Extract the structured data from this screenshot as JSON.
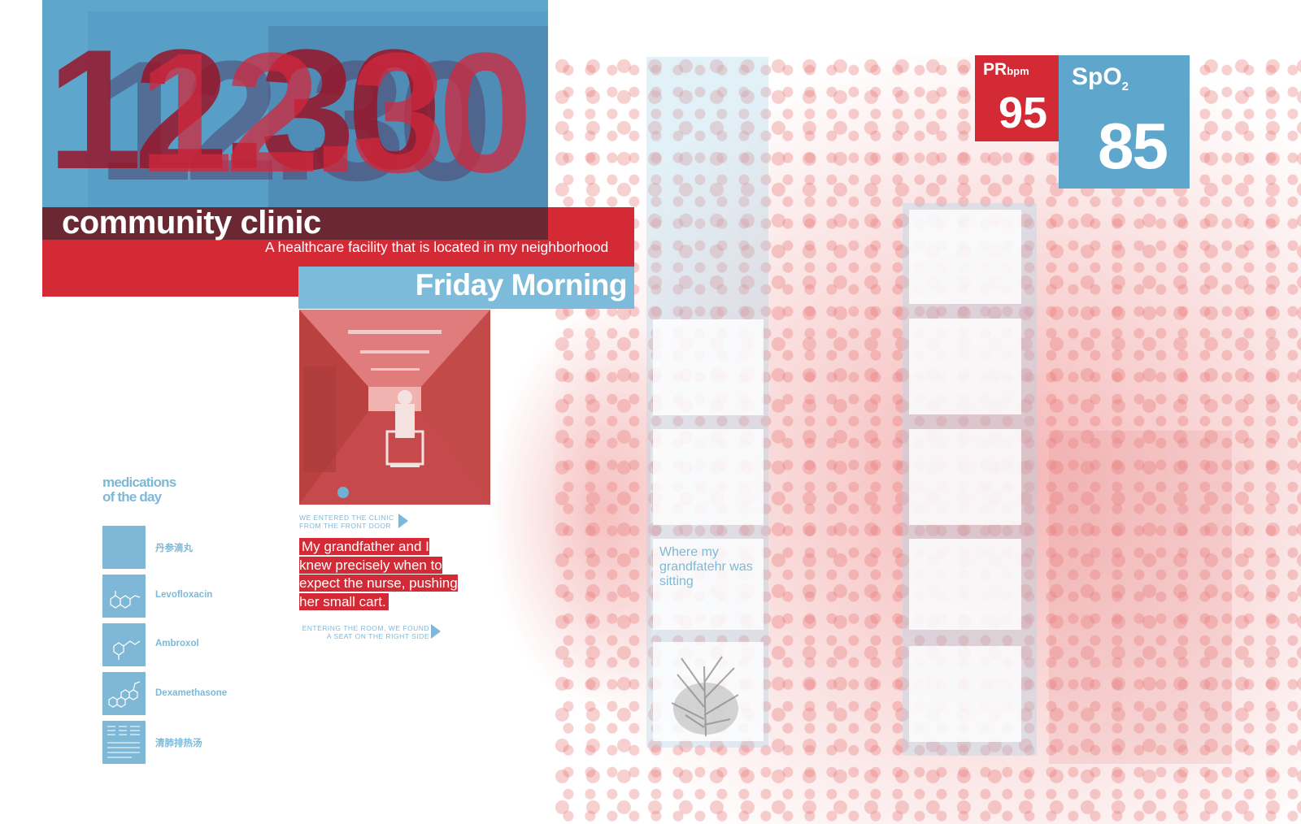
{
  "header": {
    "time": "12.30",
    "place": "community clinic",
    "subtitle": "A healthcare facility that is located in my neighborhood",
    "day": "Friday Morning"
  },
  "story": {
    "caption_top": "WE ENTERED THE CLINIC FROM THE FRONT DOOR",
    "quote": "My grandfather and I knew precisely when to expect the nurse, pushing her small cart.",
    "caption_bottom": "ENTERING THE ROOM, WE FOUND A SEAT ON THE RIGHT SIDE"
  },
  "medications": {
    "title_line1": "medications",
    "title_line2": "of the day",
    "items": [
      {
        "name": "丹参滴丸",
        "icon": "label-icon"
      },
      {
        "name": "Levofloxacin",
        "icon": "molecule-icon"
      },
      {
        "name": "Ambroxol",
        "icon": "molecule-icon"
      },
      {
        "name": "Dexamethasone",
        "icon": "molecule-icon"
      },
      {
        "name": "清肺排热汤",
        "icon": "label-icon"
      }
    ]
  },
  "vitals": {
    "pr_label": "PR",
    "pr_unit": "bpm",
    "pr_value": "95",
    "spo2_label": "SpO",
    "spo2_sub": "2",
    "spo2_value": "85"
  },
  "room": {
    "note": "Where my grandfatehr was sitting"
  },
  "colors": {
    "red": "#d32a36",
    "blue": "#5fa6cc",
    "light_blue": "#7fb8d6"
  }
}
